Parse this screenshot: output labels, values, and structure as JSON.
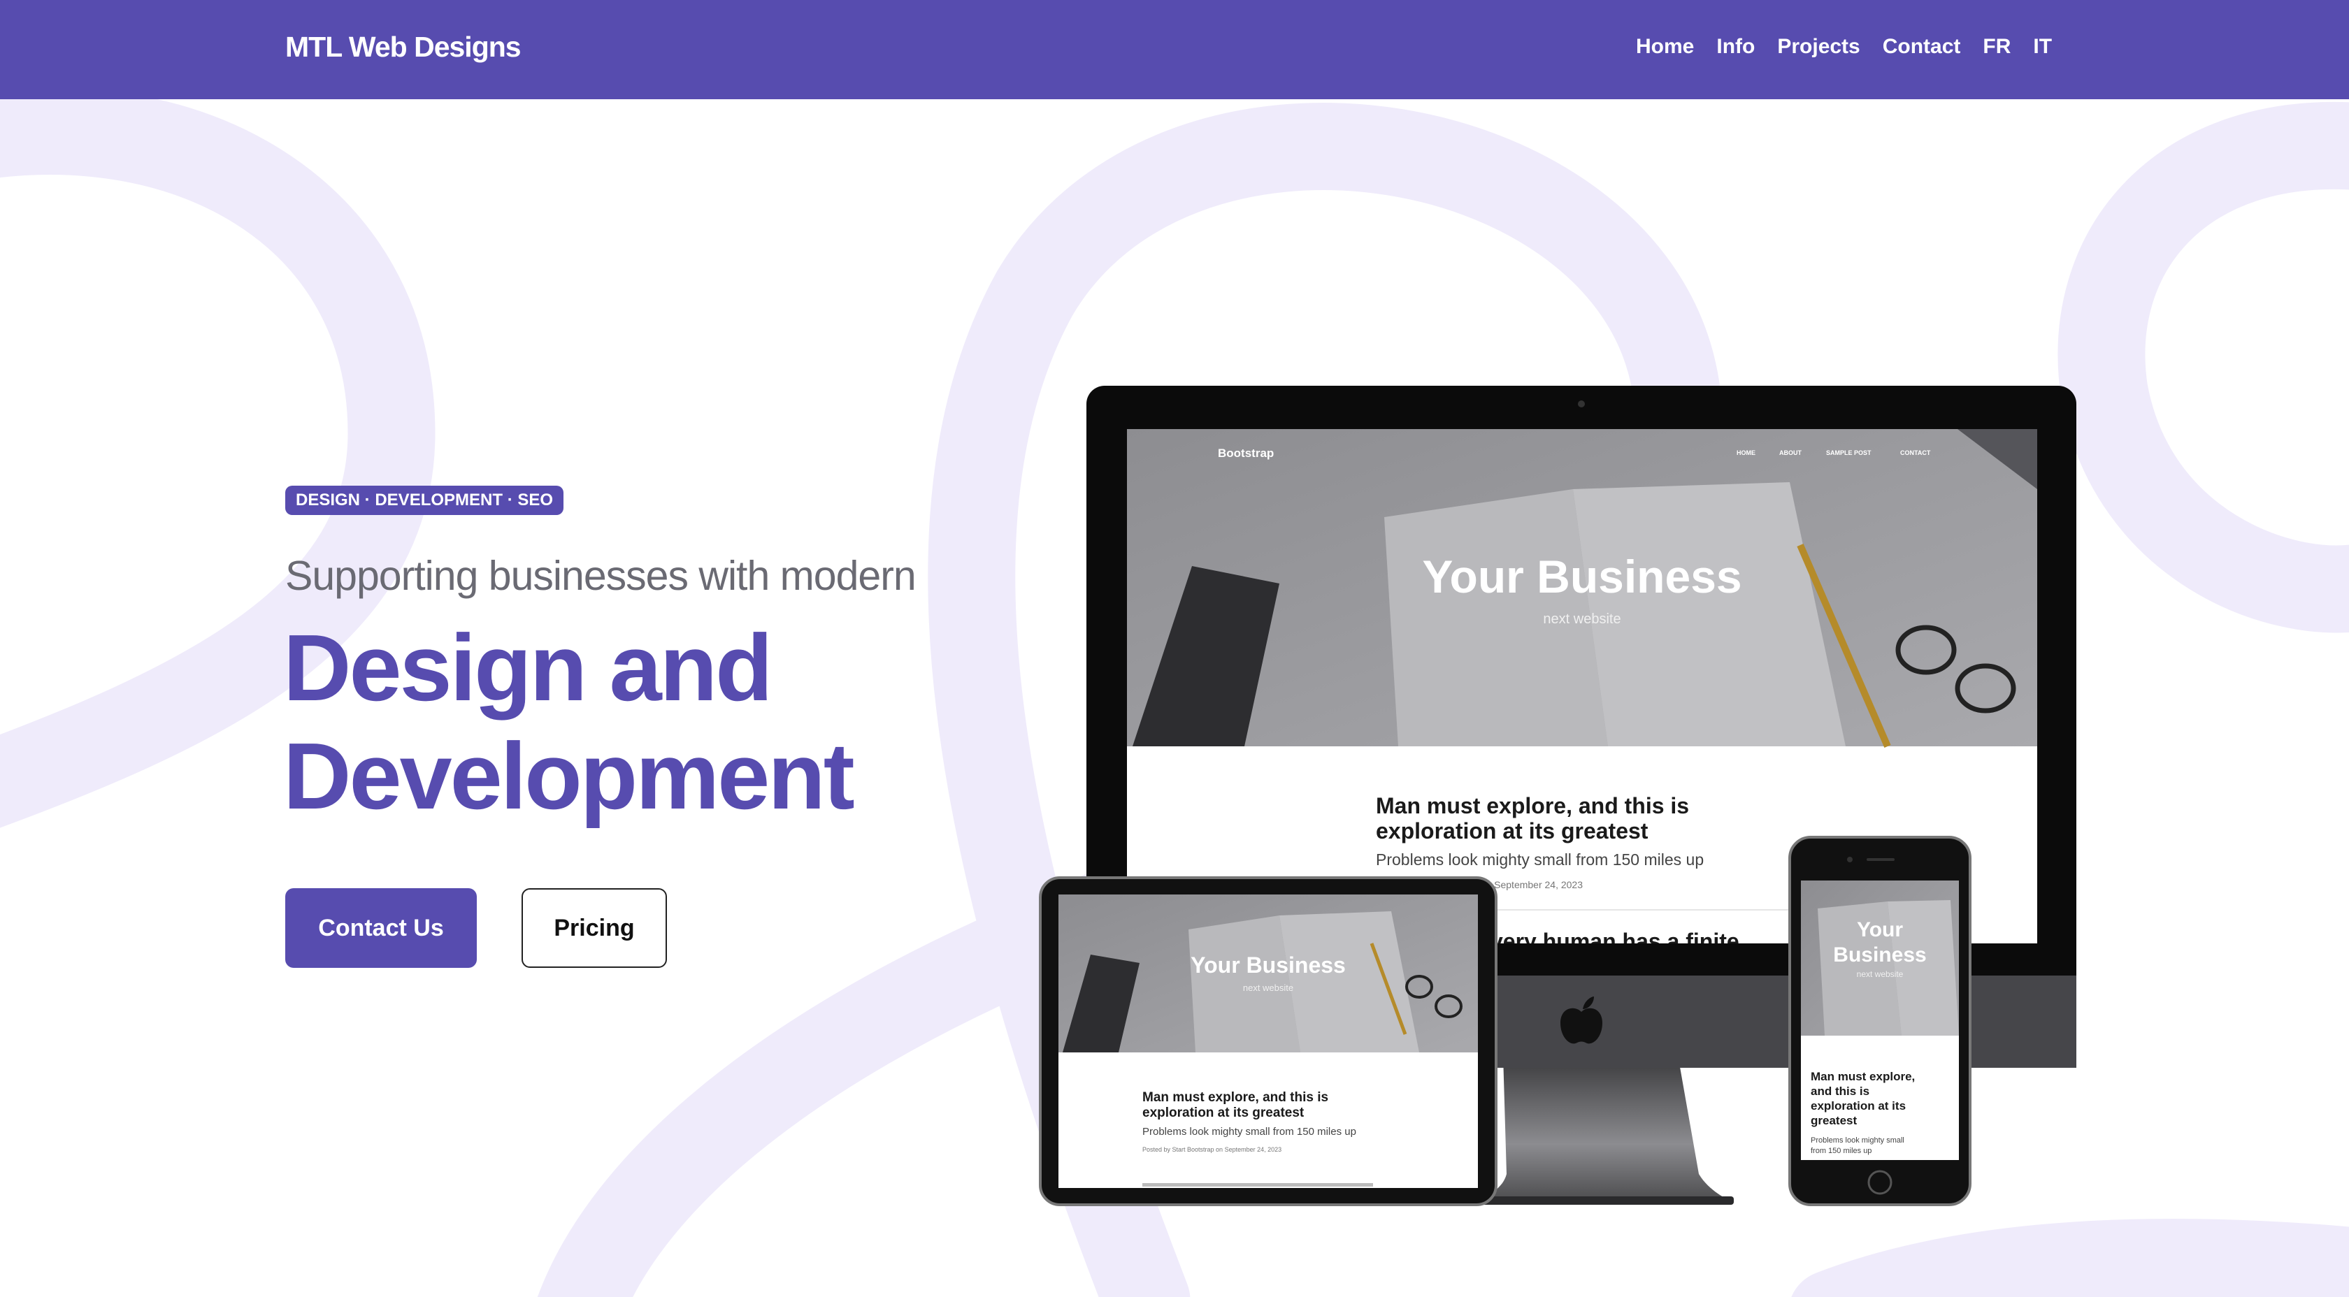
{
  "nav": {
    "brand": "MTL Web Designs",
    "links": [
      "Home",
      "Info",
      "Projects",
      "Contact",
      "FR",
      "IT"
    ]
  },
  "hero": {
    "badge": "DESIGN · DEVELOPMENT · SEO",
    "subheading": "Supporting businesses with modern",
    "headline_line1": "Design and",
    "headline_line2": "Development",
    "primary_button": "Contact Us",
    "secondary_button": "Pricing"
  },
  "mockup": {
    "site_brand": "Bootstrap",
    "site_nav": [
      "HOME",
      "ABOUT",
      "SAMPLE POST",
      "CONTACT"
    ],
    "hero_title": "Your Business",
    "hero_subtitle": "next website",
    "post_title_line1": "Man must explore, and this is",
    "post_title_line2": "exploration at its greatest",
    "post_subtitle": "Problems look mighty small from 150 miles up",
    "post_meta": "Posted by Start Bootstrap on September 24, 2023",
    "post_meta_visible": "p on September 24, 2023",
    "next_post_partial": "very human has a finite",
    "tablet_meta": "Posted by Start Bootstrap on September 24, 2023",
    "phone_title_lines": [
      "Man must explore,",
      "and this is",
      "exploration at its",
      "greatest"
    ],
    "phone_subtitle_lines": [
      "Problems look mighty small",
      "from 150 miles up"
    ],
    "phone_hero_lines": [
      "Your",
      "Business"
    ]
  },
  "colors": {
    "brand": "#574caf",
    "swirl": "#efebfb",
    "text_gray": "#6a6a73"
  }
}
